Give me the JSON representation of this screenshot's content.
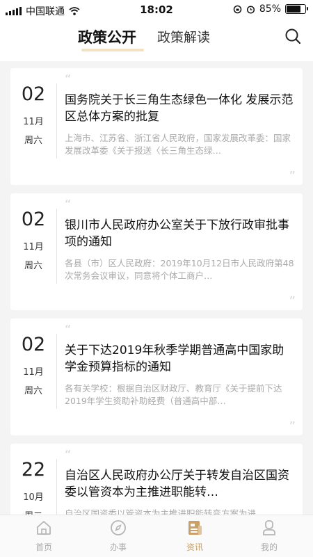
{
  "status_bar": {
    "carrier": "中国联通",
    "time": "18:02",
    "battery": "85%",
    "battery_level": 0.85
  },
  "header": {
    "tab_active": "政策公开",
    "tab_inactive": "政策解读",
    "search_icon": "search-icon"
  },
  "cards": [
    {
      "day": "02",
      "month": "11月",
      "weekday": "周六",
      "title": "国务院关于长三角生态绿色一体化  发展示范区总体方案的批复",
      "summary": "上海市、江苏省、浙江省人民政府，国家发展改革委：国家发展改革委《关于报送〈长三角生态绿…"
    },
    {
      "day": "02",
      "month": "11月",
      "weekday": "周六",
      "title": "银川市人民政府办公室关于下放行政审批事项的通知",
      "summary": "各县（市）区人民政府：2019年10月12日市人民政府第48次常务会议审议，同意将个体工商户…"
    },
    {
      "day": "02",
      "month": "11月",
      "weekday": "周六",
      "title": "关于下达2019年秋季学期普通高中国家助学金预算指标的通知",
      "summary": "各有关学校：根据自治区财政厅、教育厅《关于提前下达2019年学生资助补助经费（普通高中部…"
    },
    {
      "day": "22",
      "month": "10月",
      "weekday": "周二",
      "title": "自治区人民政府办公厅关于转发自治区国资委以管资本为主推进职能转…",
      "summary": "自治区国资委以管资本为主推进职能转变方案为进"
    }
  ],
  "quote_open": "“",
  "quote_close": "”",
  "tabbar": [
    {
      "label": "首页",
      "icon": "home-icon",
      "active": false
    },
    {
      "label": "办事",
      "icon": "compass-icon",
      "active": false
    },
    {
      "label": "资讯",
      "icon": "news-icon",
      "active": true
    },
    {
      "label": "我的",
      "icon": "profile-icon",
      "active": false
    }
  ],
  "colors": {
    "accent": "#c9a06a",
    "tab_underline": "#f3e2c2",
    "background": "#f4f4f4"
  }
}
